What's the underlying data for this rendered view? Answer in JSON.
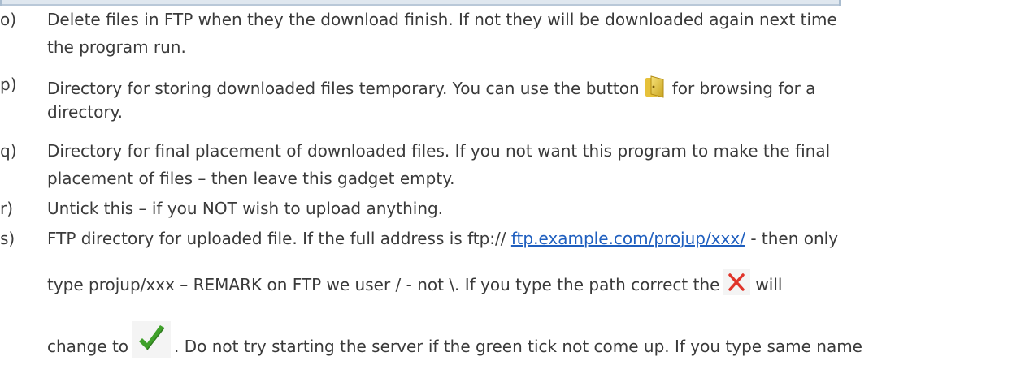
{
  "items": {
    "o": {
      "marker": "o)",
      "line1": "Delete files in FTP when they the download finish. If not they will be downloaded again next time",
      "line2": "the program run."
    },
    "p": {
      "marker": "p)",
      "line1_before": "Directory for storing downloaded files temporary. You can use the button",
      "line1_after": "for browsing for a",
      "line2": "directory.",
      "icon": "folder-icon"
    },
    "q": {
      "marker": "q)",
      "line1": "Directory for final placement of downloaded files. If you not want this program to make the final",
      "line2": "placement of files – then leave this gadget empty."
    },
    "r": {
      "marker": "r)",
      "line1": "Untick this – if you NOT wish to upload anything."
    },
    "s": {
      "marker": "s)",
      "line1_before": "FTP directory for uploaded file. If the full address is ftp://",
      "link": "ftp.example.com/projup/xxx/",
      "line1_after": "- then only",
      "line2_before": "type projup/xxx – REMARK on FTP we user / - not \\. If you type the path correct the",
      "line2_after": "will",
      "line3_before": "change to",
      "line3_after": ". Do not try starting the server if the green tick not come up. If you type same name",
      "icons": [
        "red-cross-icon",
        "green-tick-icon"
      ],
      "colors": {
        "link": "#1f5fbf",
        "cross": "#e0342a",
        "tick": "#3fa12a"
      }
    }
  }
}
